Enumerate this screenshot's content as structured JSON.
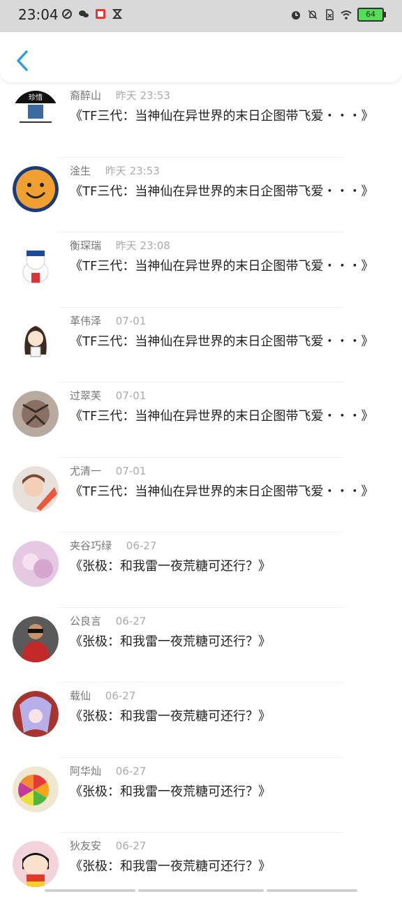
{
  "status_bar": {
    "time": "23:04",
    "battery": "64",
    "left_icons": [
      "nfc-icon",
      "wechat-icon",
      "app-badge-icon",
      "hourglass-icon"
    ],
    "right_icons": [
      "alarm-icon",
      "mute-icon",
      "no-sim-icon",
      "wifi-icon",
      "battery-icon"
    ]
  },
  "header": {
    "back_icon": "chevron-left-icon"
  },
  "colors": {
    "accent": "#2a9de6"
  },
  "messages": [
    {
      "name": "裔醉山",
      "time": "昨天 23:53",
      "text": "《TF三代：当神仙在异世界的末日企图带飞爱・・・》",
      "avatar_label": "珍惜"
    },
    {
      "name": "淦生",
      "time": "昨天 23:53",
      "text": "《TF三代：当神仙在异世界的末日企图带飞爱・・・》"
    },
    {
      "name": "衡琛瑞",
      "time": "昨天 23:08",
      "text": "《TF三代：当神仙在异世界的末日企图带飞爱・・・》"
    },
    {
      "name": "革伟泽",
      "time": "07-01",
      "text": "《TF三代：当神仙在异世界的末日企图带飞爱・・・》"
    },
    {
      "name": "过翠芙",
      "time": "07-01",
      "text": "《TF三代：当神仙在异世界的末日企图带飞爱・・・》"
    },
    {
      "name": "尤清一",
      "time": "07-01",
      "text": "《TF三代：当神仙在异世界的末日企图带飞爱・・・》"
    },
    {
      "name": "夹谷巧绿",
      "time": "06-27",
      "text": "《张极：和我雷一夜荒糖可还行？》"
    },
    {
      "name": "公良言",
      "time": "06-27",
      "text": "《张极：和我雷一夜荒糖可还行？》"
    },
    {
      "name": "载仙",
      "time": "06-27",
      "text": "《张极：和我雷一夜荒糖可还行？》"
    },
    {
      "name": "阿华灿",
      "time": "06-27",
      "text": "《张极：和我雷一夜荒糖可还行？》"
    },
    {
      "name": "狄友安",
      "time": "06-27",
      "text": "《张极：和我雷一夜荒糖可还行？》"
    }
  ]
}
